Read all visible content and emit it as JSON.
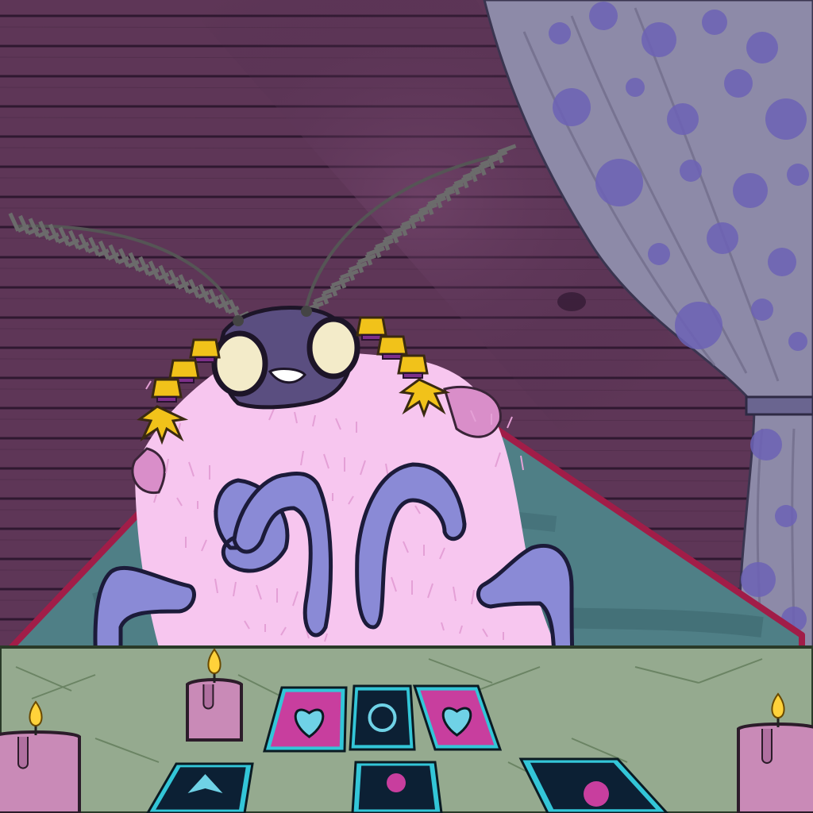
{
  "scene": {
    "colors": {
      "wall": "#5e3657",
      "wall_dark": "#4a2a45",
      "wall_line": "#2f1830",
      "curtain": "#8d8aa8",
      "curtain_dots": "#6c62b5",
      "cape": "#4f7f86",
      "cape_edge": "#a11d48",
      "fur": "#f7c6ef",
      "fur_shadow": "#e7a8dc",
      "arms": "#8a8ad6",
      "head": "#5a4e80",
      "eyes": "#f3ebc9",
      "hair": "#f1c21a",
      "table": "#95aa8f",
      "table_line": "#6b8464",
      "candle": "#c98ab7",
      "flame": "#ffd23a",
      "card_frame": "#33c6d8",
      "card_back": "#0c2034",
      "card_pink": "#c83e9e"
    },
    "icons": [
      "moth-character",
      "feather-antenna-icon",
      "candle-icon",
      "tarot-card-icon",
      "curtain-icon"
    ]
  }
}
